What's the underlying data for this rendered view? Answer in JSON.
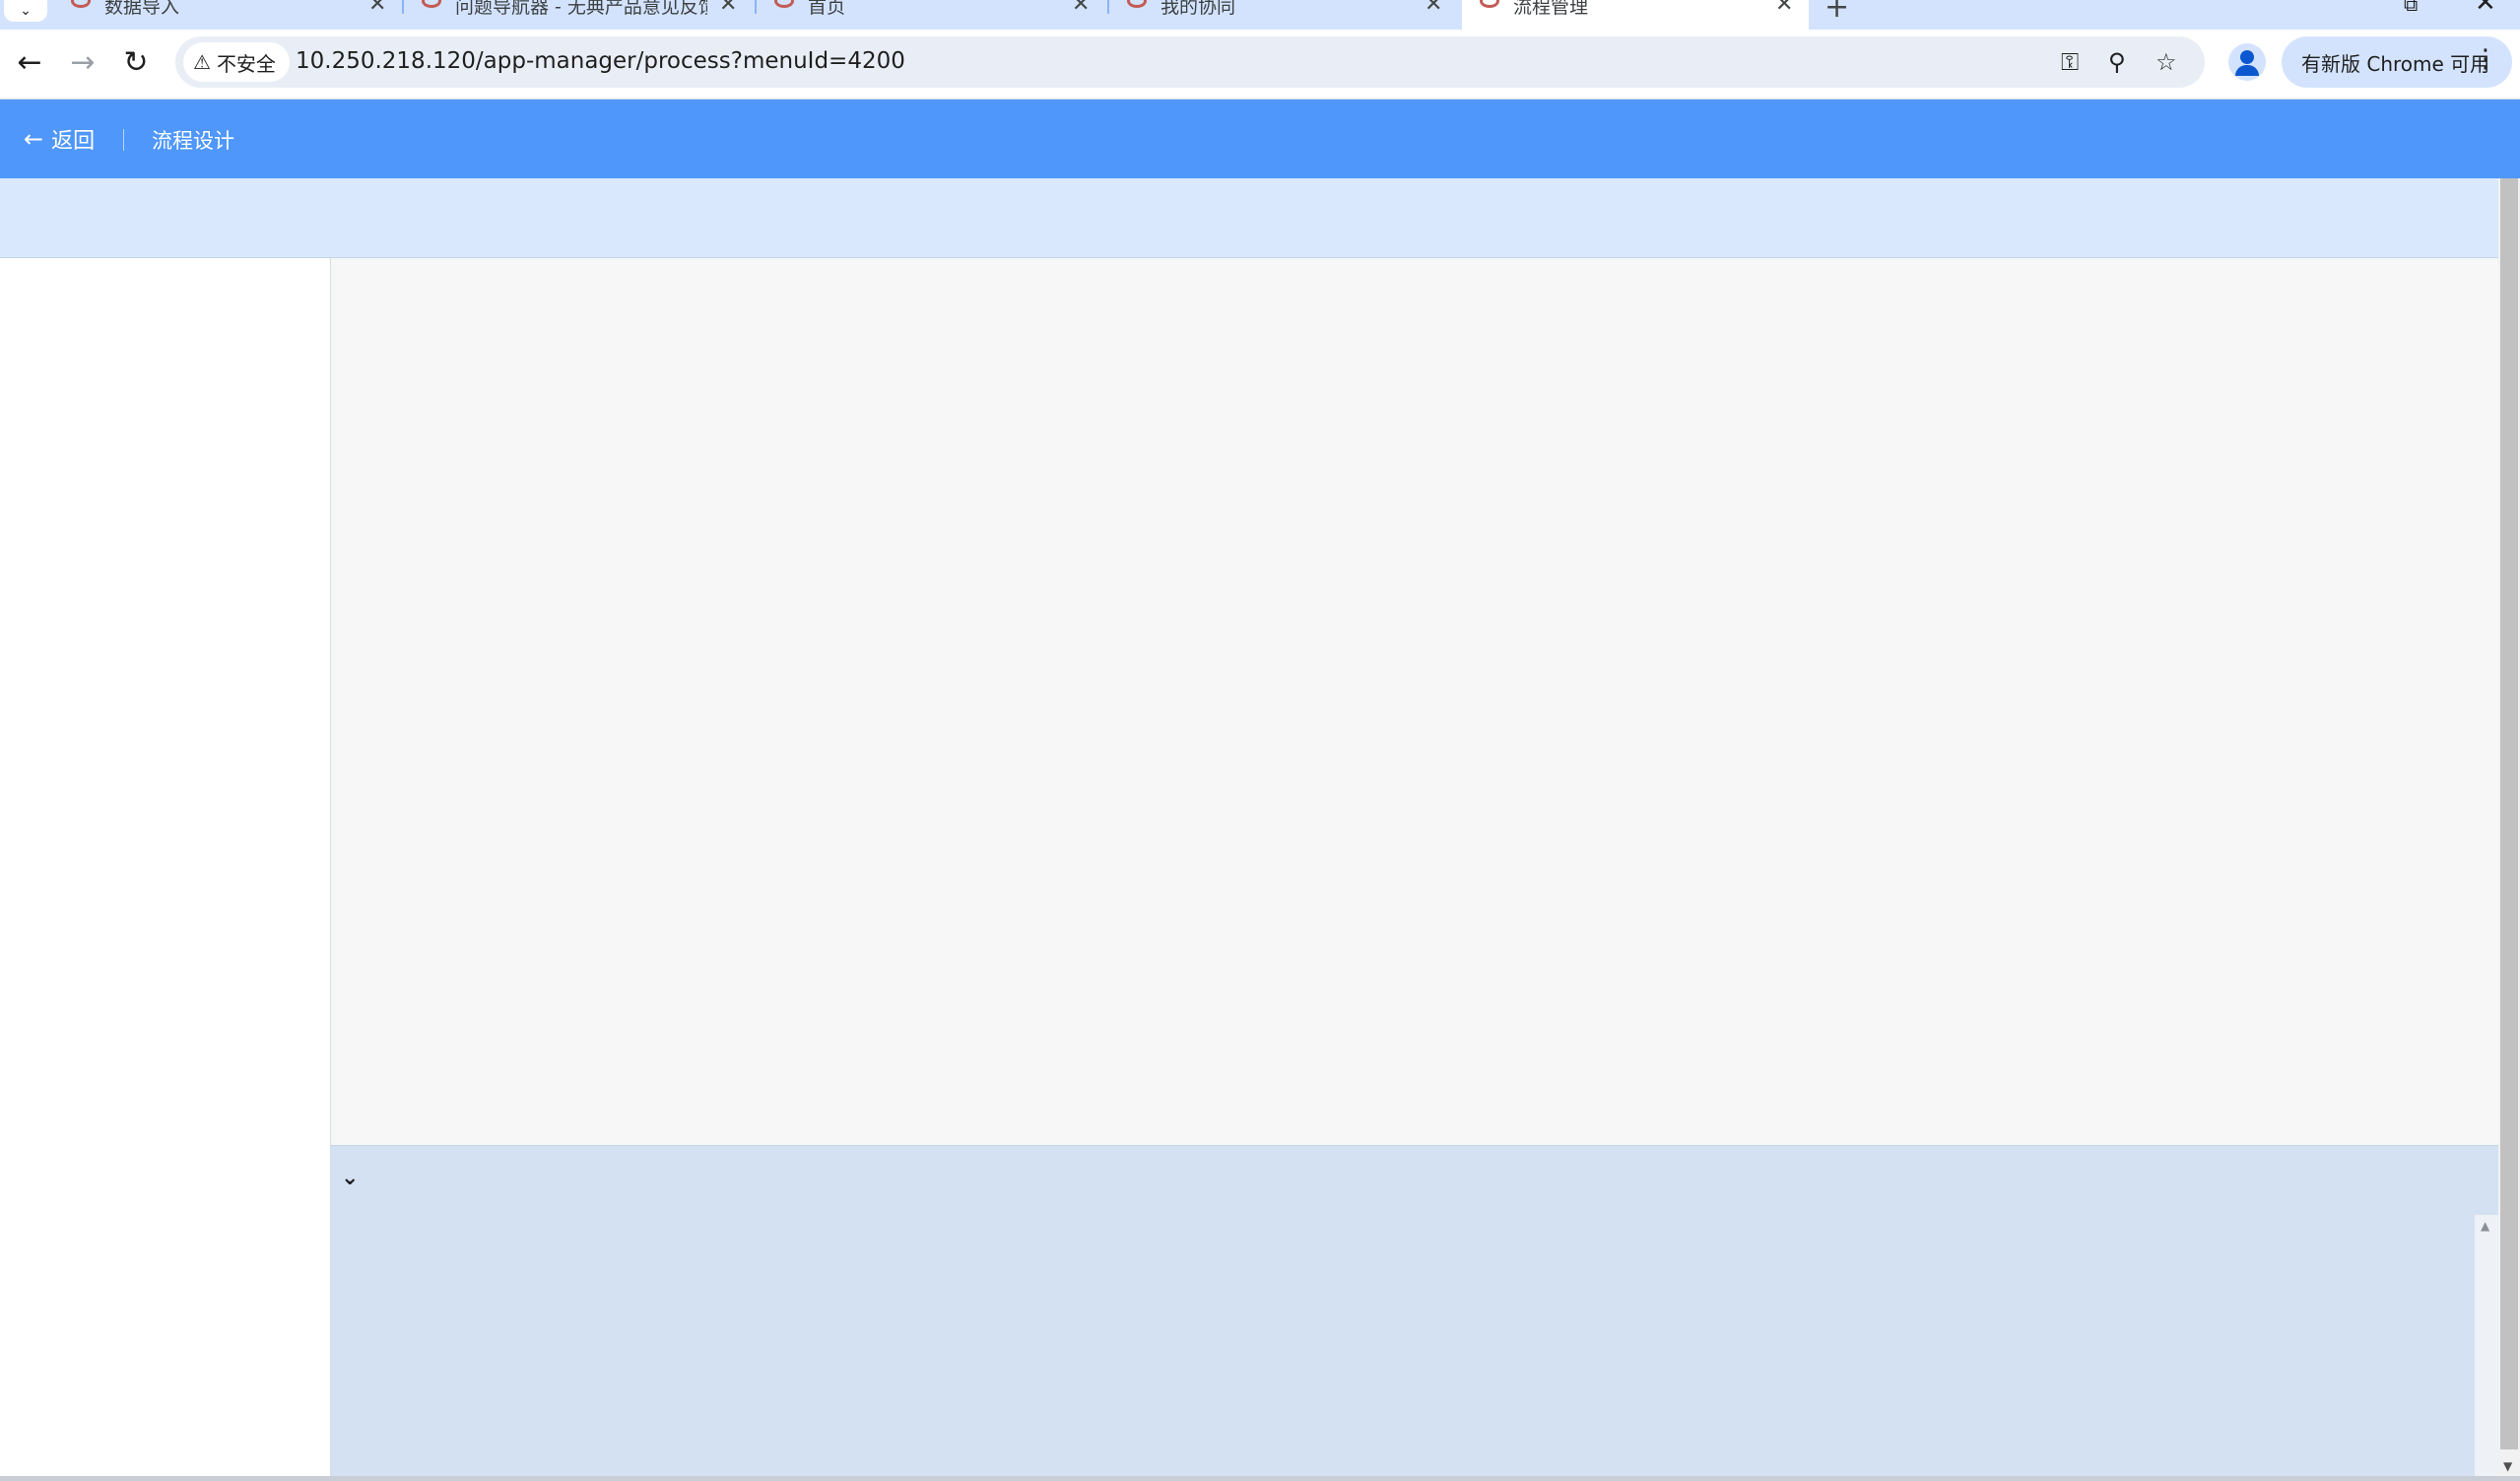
{
  "browser": {
    "tabs": [
      {
        "title": "数据导入",
        "active": false
      },
      {
        "title": "问题导航器 - 无典产品意见反馈",
        "active": false
      },
      {
        "title": "首页",
        "active": false
      },
      {
        "title": "我的协同",
        "active": false
      },
      {
        "title": "流程管理",
        "active": true
      }
    ],
    "security_label": "不安全",
    "url": "10.250.218.120/app-manager/process?menuId=4200",
    "update_button": "有新版 Chrome 可用",
    "icons": {
      "back": "←",
      "forward": "→",
      "reload": "↻",
      "key": "⚿",
      "zoom": "⚲",
      "star": "☆",
      "menu": "⋮",
      "new_tab": "+",
      "close": "✕"
    }
  },
  "app": {
    "back_label": "返回",
    "page_title": "流程设计",
    "header_color": "#4f97fb"
  }
}
